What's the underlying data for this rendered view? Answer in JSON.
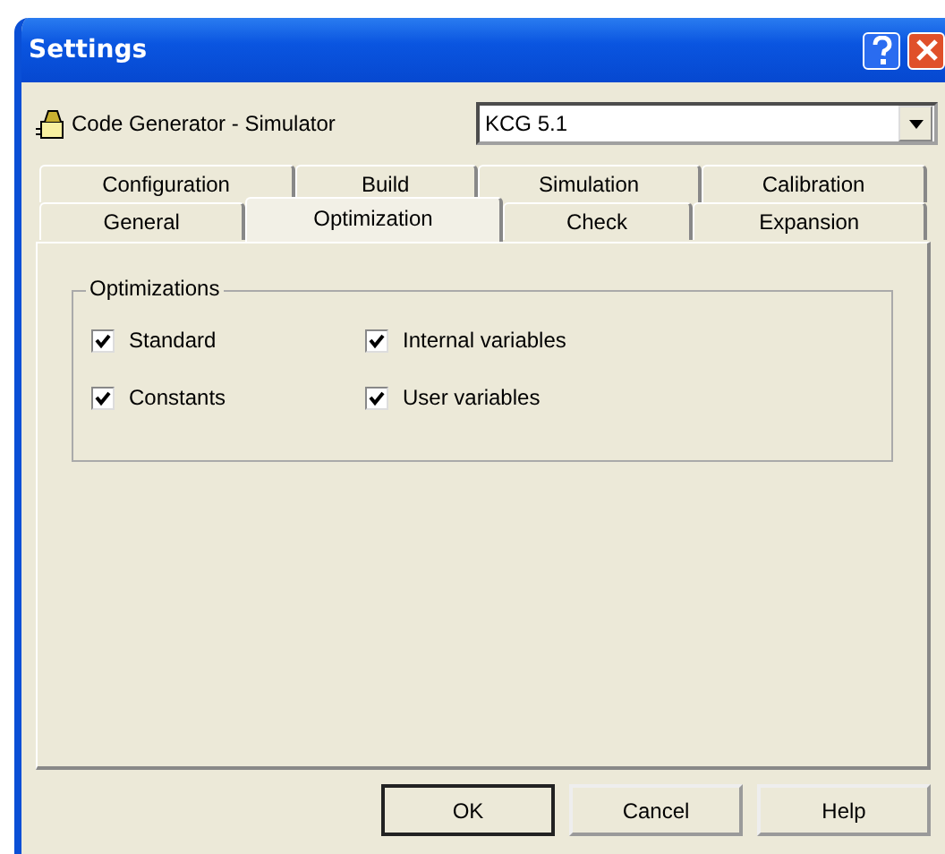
{
  "window": {
    "title": "Settings"
  },
  "target": {
    "label": "Code Generator - Simulator",
    "value": "KCG 5.1"
  },
  "tab_rows": [
    [
      {
        "label": "Configuration",
        "selected": false
      },
      {
        "label": "Build",
        "selected": false
      },
      {
        "label": "Simulation",
        "selected": false
      },
      {
        "label": "Calibration",
        "selected": false
      }
    ],
    [
      {
        "label": "General",
        "selected": false
      },
      {
        "label": "Optimization",
        "selected": true
      },
      {
        "label": "Check",
        "selected": false
      },
      {
        "label": "Expansion",
        "selected": false
      }
    ]
  ],
  "group": {
    "title": "Optimizations",
    "options": [
      {
        "label": "Standard",
        "checked": true
      },
      {
        "label": "Internal variables",
        "checked": true
      },
      {
        "label": "Constants",
        "checked": true
      },
      {
        "label": "User variables",
        "checked": true
      }
    ]
  },
  "buttons": [
    {
      "label": "OK",
      "default": true
    },
    {
      "label": "Cancel",
      "default": false
    },
    {
      "label": "Help",
      "default": false
    }
  ]
}
